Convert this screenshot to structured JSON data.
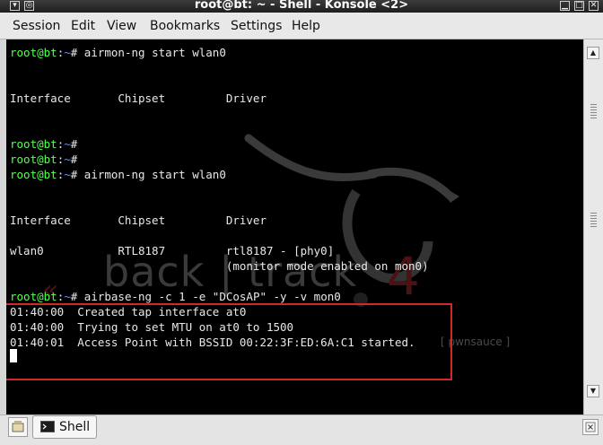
{
  "window": {
    "title": "root@bt: ~ - Shell - Konsole <2>"
  },
  "menu": [
    "Session",
    "Edit",
    "View",
    "Bookmarks",
    "Settings",
    "Help"
  ],
  "prompt": {
    "user_host": "root@bt",
    "sep": ":",
    "path": "~",
    "symbol": "#"
  },
  "terminal": {
    "cmd1": " airmon-ng start wlan0",
    "header1": "Interface       Chipset         Driver",
    "cmd2": "",
    "cmd3": "",
    "cmd4": " airmon-ng start wlan0",
    "header2": "Interface       Chipset         Driver",
    "row1": "wlan0           RTL8187         rtl8187 - [phy0]",
    "row2": "                                (monitor mode enabled on mon0)",
    "cmd5": " airbase-ng -c 1 -e \"DCosAP\" -y -v mon0",
    "out1": "01:40:00  Created tap interface at0",
    "out2": "01:40:00  Trying to set MTU on at0 to 1500",
    "out3": "01:40:01  Access Point with BSSID 00:22:3F:ED:6A:C1 started."
  },
  "wallpaper": {
    "brand": "back | track",
    "version": "4",
    "credit": "[ pwnsauce ]"
  },
  "tabs": [
    {
      "label": "Shell"
    }
  ],
  "colors": {
    "prompt_user": "#55ff55",
    "prompt_path": "#5c8cff",
    "highlight": "#d0292c"
  }
}
